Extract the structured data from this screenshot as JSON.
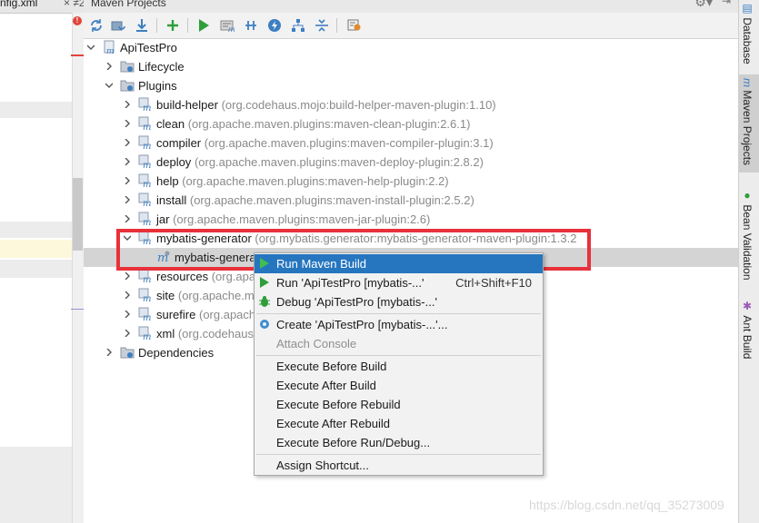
{
  "editor": {
    "tab_label": "nfig.xml",
    "tab_extra": "× ≠2",
    "error_mark": "!"
  },
  "panel": {
    "title": "Maven Projects",
    "toolbar": [
      {
        "name": "reimport-icon"
      },
      {
        "name": "generate-sources-icon"
      },
      {
        "name": "download-icon"
      },
      {
        "name": "add-icon"
      },
      {
        "name": "run-icon"
      },
      {
        "name": "execute-goal-icon"
      },
      {
        "name": "toggle-offline-icon"
      },
      {
        "name": "skip-tests-icon"
      },
      {
        "name": "show-dependencies-icon"
      },
      {
        "name": "collapse-all-icon"
      },
      {
        "name": "settings-icon"
      }
    ],
    "tree": {
      "root": "ApiTestPro",
      "lifecycle": "Lifecycle",
      "plugins": "Plugins",
      "plugin_items": [
        {
          "name": "build-helper",
          "coord": "(org.codehaus.mojo:build-helper-maven-plugin:1.10)"
        },
        {
          "name": "clean",
          "coord": "(org.apache.maven.plugins:maven-clean-plugin:2.6.1)"
        },
        {
          "name": "compiler",
          "coord": "(org.apache.maven.plugins:maven-compiler-plugin:3.1)"
        },
        {
          "name": "deploy",
          "coord": "(org.apache.maven.plugins:maven-deploy-plugin:2.8.2)"
        },
        {
          "name": "help",
          "coord": "(org.apache.maven.plugins:maven-help-plugin:2.2)"
        },
        {
          "name": "install",
          "coord": "(org.apache.maven.plugins:maven-install-plugin:2.5.2)"
        },
        {
          "name": "jar",
          "coord": "(org.apache.maven.plugins:maven-jar-plugin:2.6)"
        },
        {
          "name": "mybatis-generator",
          "coord": "(org.mybatis.generator:mybatis-generator-maven-plugin:1.3.2"
        },
        {
          "name": "mybatis-genera",
          "coord": ""
        },
        {
          "name": "resources",
          "coord": "(org.apa"
        },
        {
          "name": "site",
          "coord": "(org.apache.m"
        },
        {
          "name": "surefire",
          "coord": "(org.apach"
        },
        {
          "name": "xml",
          "coord": "(org.codehaus"
        }
      ],
      "dependencies": "Dependencies"
    }
  },
  "context_menu": {
    "items": [
      {
        "label": "Run Maven Build",
        "shortcut": ""
      },
      {
        "label": "Run 'ApiTestPro [mybatis-...'",
        "shortcut": "Ctrl+Shift+F10"
      },
      {
        "label": "Debug 'ApiTestPro [mybatis-...'",
        "shortcut": ""
      },
      {
        "label": "Create 'ApiTestPro [mybatis-...'...",
        "shortcut": ""
      },
      {
        "label": "Attach Console",
        "shortcut": ""
      },
      {
        "label": "Execute Before Build",
        "shortcut": ""
      },
      {
        "label": "Execute After Build",
        "shortcut": ""
      },
      {
        "label": "Execute Before Rebuild",
        "shortcut": ""
      },
      {
        "label": "Execute After Rebuild",
        "shortcut": ""
      },
      {
        "label": "Execute Before Run/Debug...",
        "shortcut": ""
      },
      {
        "label": "Assign Shortcut...",
        "shortcut": ""
      }
    ]
  },
  "tool_strip": {
    "database": "Database",
    "maven_projects": "Maven Projects",
    "bean_validation": "Bean Validation",
    "ant_build": "Ant Build"
  },
  "watermark": "https://blog.csdn.net/qq_35273009",
  "colors": {
    "highlight_red": "#e8313a",
    "menu_selection": "#2675bf",
    "run_green": "#2f9e3a",
    "maven_blue": "#3d7fc1"
  }
}
